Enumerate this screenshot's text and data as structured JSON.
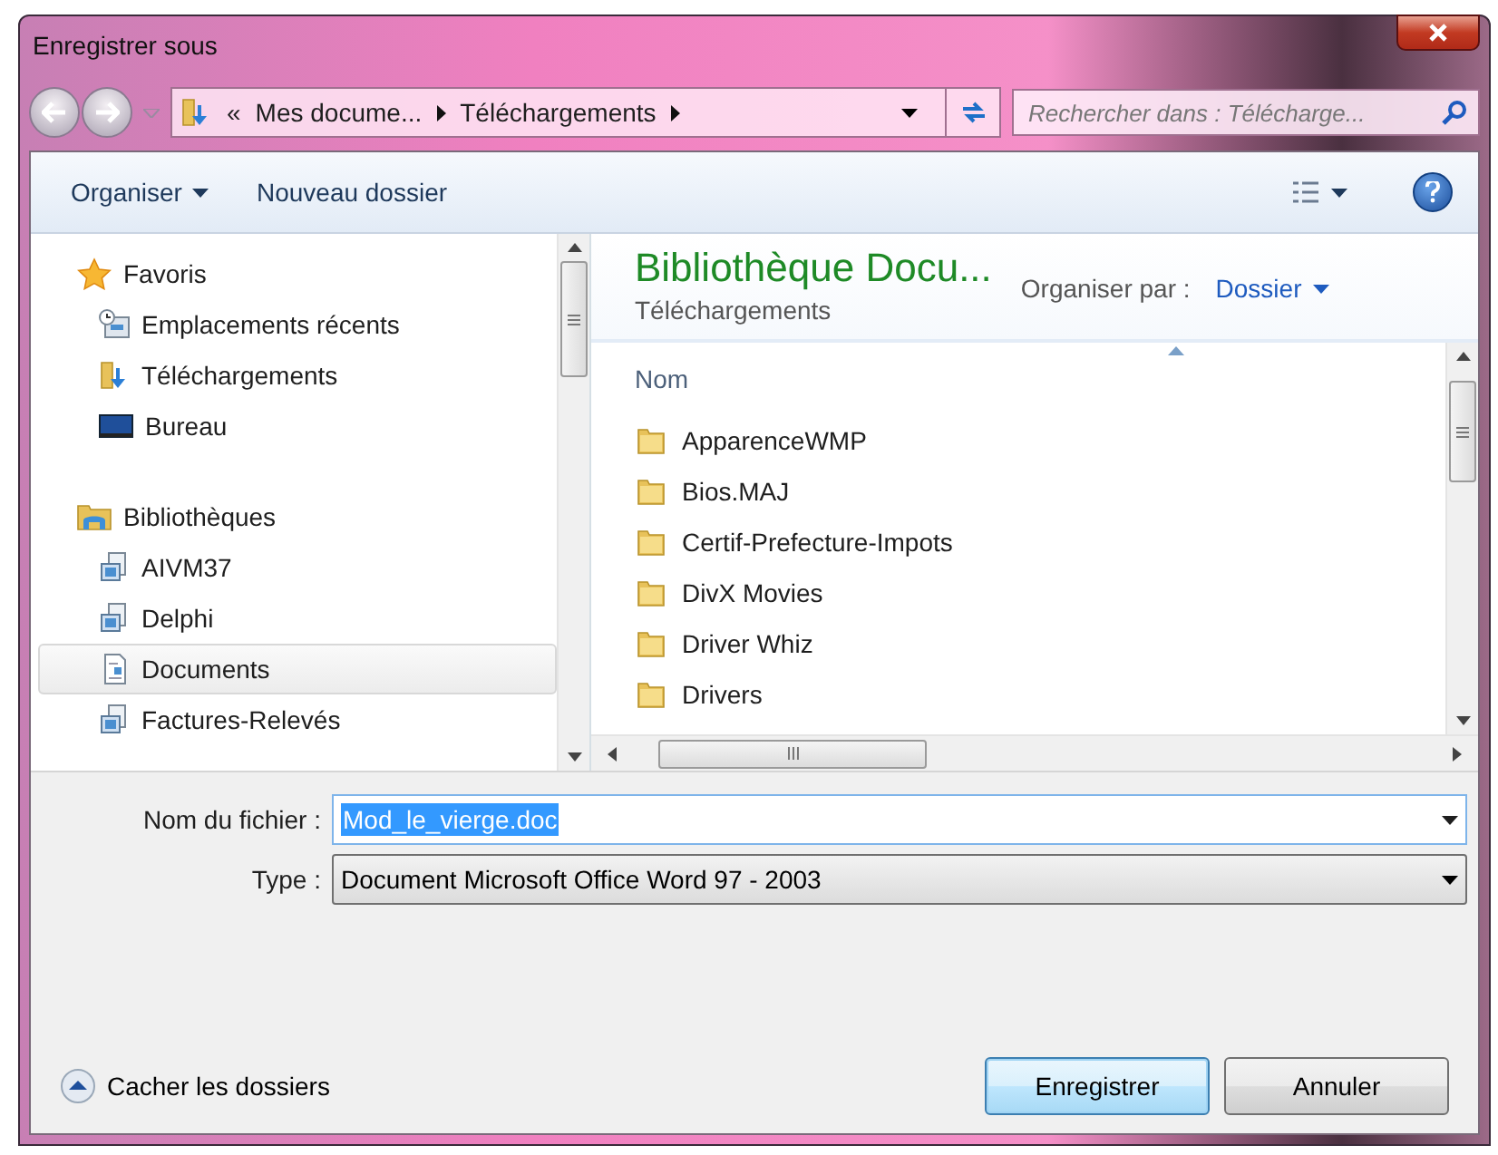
{
  "window": {
    "title": "Enregistrer sous"
  },
  "address_bar": {
    "overflow": "«",
    "segments": [
      "Mes docume...",
      "Téléchargements"
    ]
  },
  "search": {
    "placeholder": "Rechercher dans : Télécharge..."
  },
  "toolbar": {
    "organize": "Organiser",
    "new_folder": "Nouveau dossier"
  },
  "sidebar": {
    "groups": [
      {
        "label": "Favoris",
        "kind": "favorites",
        "children": [
          {
            "label": "Emplacements récents",
            "kind": "recent",
            "selected": false
          },
          {
            "label": "Téléchargements",
            "kind": "downloads",
            "selected": false
          },
          {
            "label": "Bureau",
            "kind": "desktop",
            "selected": false
          }
        ]
      },
      {
        "label": "Bibliothèques",
        "kind": "libraries",
        "children": [
          {
            "label": "AIVM37",
            "kind": "library",
            "selected": false
          },
          {
            "label": "Delphi",
            "kind": "library",
            "selected": false
          },
          {
            "label": "Documents",
            "kind": "documents",
            "selected": true
          },
          {
            "label": "Factures-Relevés",
            "kind": "library",
            "selected": false
          }
        ]
      }
    ]
  },
  "content": {
    "title": "Bibliothèque Docu...",
    "subtitle": "Téléchargements",
    "arrange_label": "Organiser par :",
    "arrange_value": "Dossier",
    "columns": [
      "Nom"
    ],
    "rows": [
      {
        "name": "ApparenceWMP",
        "kind": "folder"
      },
      {
        "name": "Bios.MAJ",
        "kind": "folder"
      },
      {
        "name": "Certif-Prefecture-Impots",
        "kind": "folder"
      },
      {
        "name": "DivX Movies",
        "kind": "folder"
      },
      {
        "name": "Driver Whiz",
        "kind": "folder"
      },
      {
        "name": "Drivers",
        "kind": "folder"
      }
    ]
  },
  "form": {
    "filename_label": "Nom du fichier :",
    "filename_value": "Mod_le_vierge.doc",
    "type_label": "Type :",
    "type_value": "Document Microsoft Office Word 97 - 2003"
  },
  "footer": {
    "hide_folders": "Cacher les dossiers",
    "buttons": [
      {
        "label": "Enregistrer",
        "kind": "primary"
      },
      {
        "label": "Annuler",
        "kind": "secondary"
      }
    ]
  }
}
